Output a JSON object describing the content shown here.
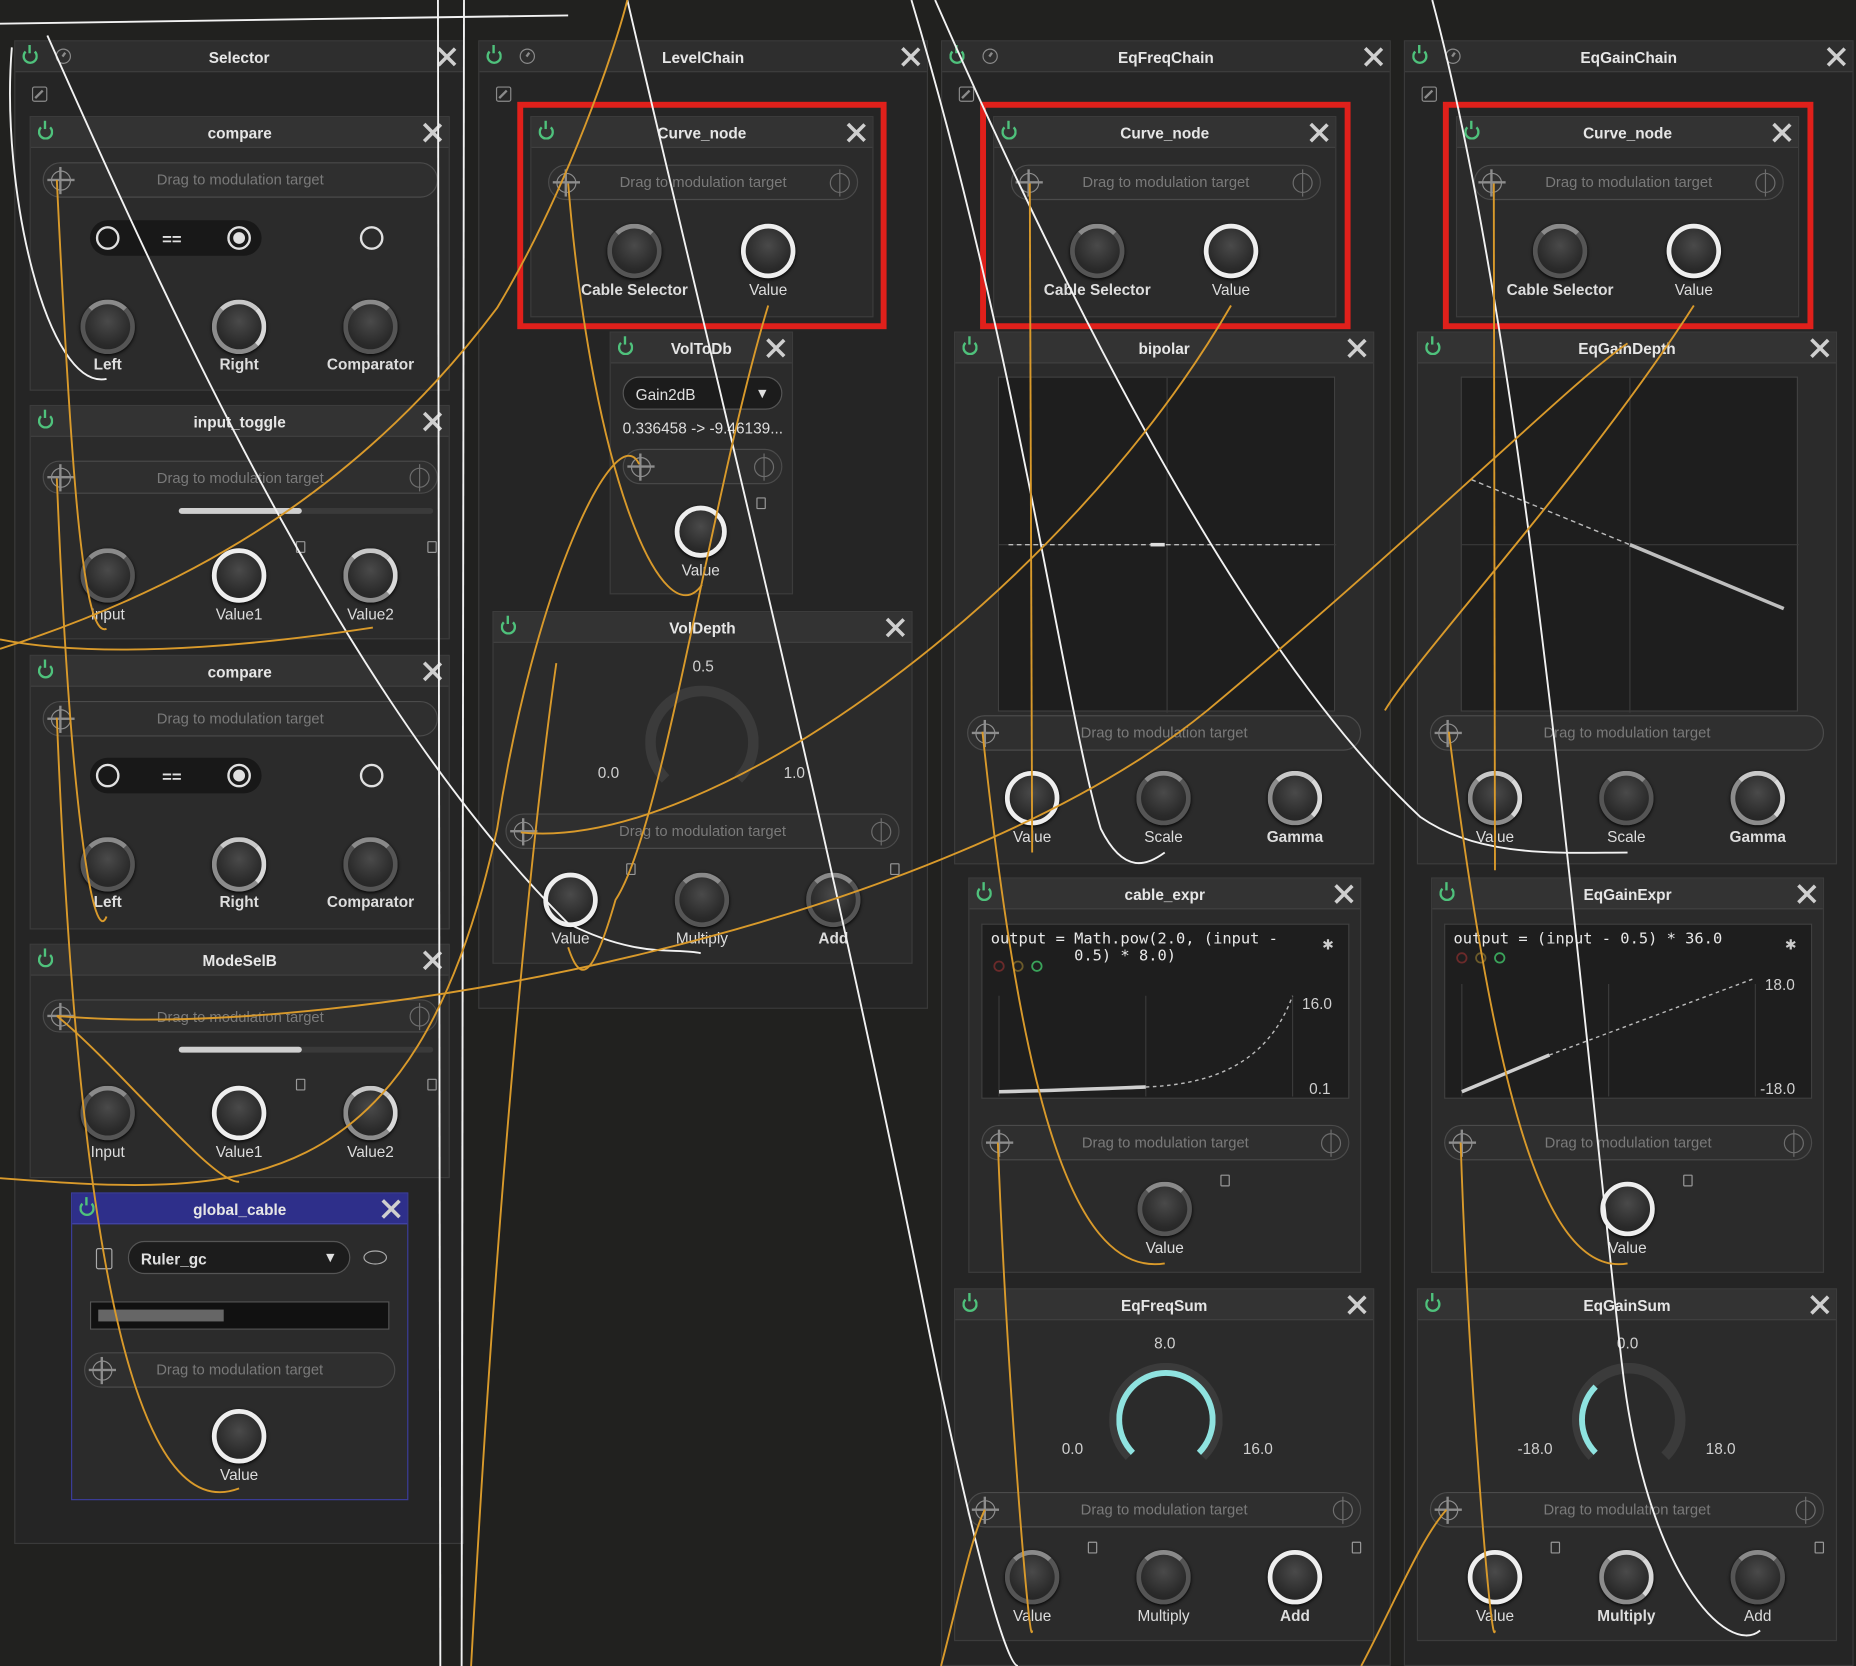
{
  "common": {
    "drag_label": "Drag to modulation target"
  },
  "chains": {
    "selector": {
      "title": "Selector"
    },
    "level": {
      "title": "LevelChain"
    },
    "eqfreq": {
      "title": "EqFreqChain"
    },
    "eqgain": {
      "title": "EqGainChain"
    }
  },
  "selector_nodes": {
    "compare1": {
      "title": "compare",
      "operator": "==",
      "knobs": [
        "Left",
        "Right",
        "Comparator"
      ]
    },
    "input_toggle": {
      "title": "input_toggle",
      "knobs": [
        "Input",
        "Value1",
        "Value2"
      ]
    },
    "compare2": {
      "title": "compare",
      "operator": "==",
      "knobs": [
        "Left",
        "Right",
        "Comparator"
      ]
    },
    "modesel": {
      "title": "ModeSelB",
      "knobs": [
        "Input",
        "Value1",
        "Value2"
      ]
    },
    "global_cable": {
      "title": "global_cable",
      "selected": "Ruler_gc",
      "progress": 0.43,
      "knob": "Value"
    }
  },
  "level_nodes": {
    "curve": {
      "title": "Curve_node",
      "knobs": [
        "Cable Selector",
        "Value"
      ]
    },
    "voltodb": {
      "title": "VolToDb",
      "mode": "Gain2dB",
      "readout": "0.336458 -> -9.46139...",
      "knob": "Value"
    },
    "voldepth": {
      "title": "VolDepth",
      "value": "0.5",
      "min": "0.0",
      "max": "1.0",
      "knobs": [
        "Value",
        "Multiply",
        "Add"
      ]
    }
  },
  "eqfreq_nodes": {
    "curve": {
      "title": "Curve_node",
      "knobs": [
        "Cable Selector",
        "Value"
      ]
    },
    "bipolar": {
      "title": "bipolar",
      "knobs": [
        "Value",
        "Scale",
        "Gamma"
      ]
    },
    "cable_expr": {
      "title": "cable_expr",
      "code": "output = Math.pow(2.0, (input -\n         0.5) * 8.0)",
      "ymax": "16.0",
      "ymin": "0.1",
      "knob": "Value"
    },
    "sum": {
      "title": "EqFreqSum",
      "value": "8.0",
      "min": "0.0",
      "max": "16.0",
      "knobs": [
        "Value",
        "Multiply",
        "Add"
      ]
    }
  },
  "eqgain_nodes": {
    "curve": {
      "title": "Curve_node",
      "knobs": [
        "Cable Selector",
        "Value"
      ]
    },
    "depth": {
      "title": "EqGainDepth",
      "knobs": [
        "Value",
        "Scale",
        "Gamma"
      ]
    },
    "expr": {
      "title": "EqGainExpr",
      "code": "output = (input - 0.5) * 36.0",
      "ymax": "18.0",
      "ymin": "-18.0",
      "knob": "Value"
    },
    "sum": {
      "title": "EqGainSum",
      "value": "0.0",
      "min": "-18.0",
      "max": "18.0",
      "knobs": [
        "Value",
        "Multiply",
        "Add"
      ]
    }
  },
  "colors": {
    "highlight": "#e0201b",
    "power": "#4fc27c",
    "cable_orange": "#d99a2b",
    "cable_white": "#f2f2f2",
    "global_cable_header": "#2e2f8a",
    "accent_teal": "#8fe3e0"
  }
}
